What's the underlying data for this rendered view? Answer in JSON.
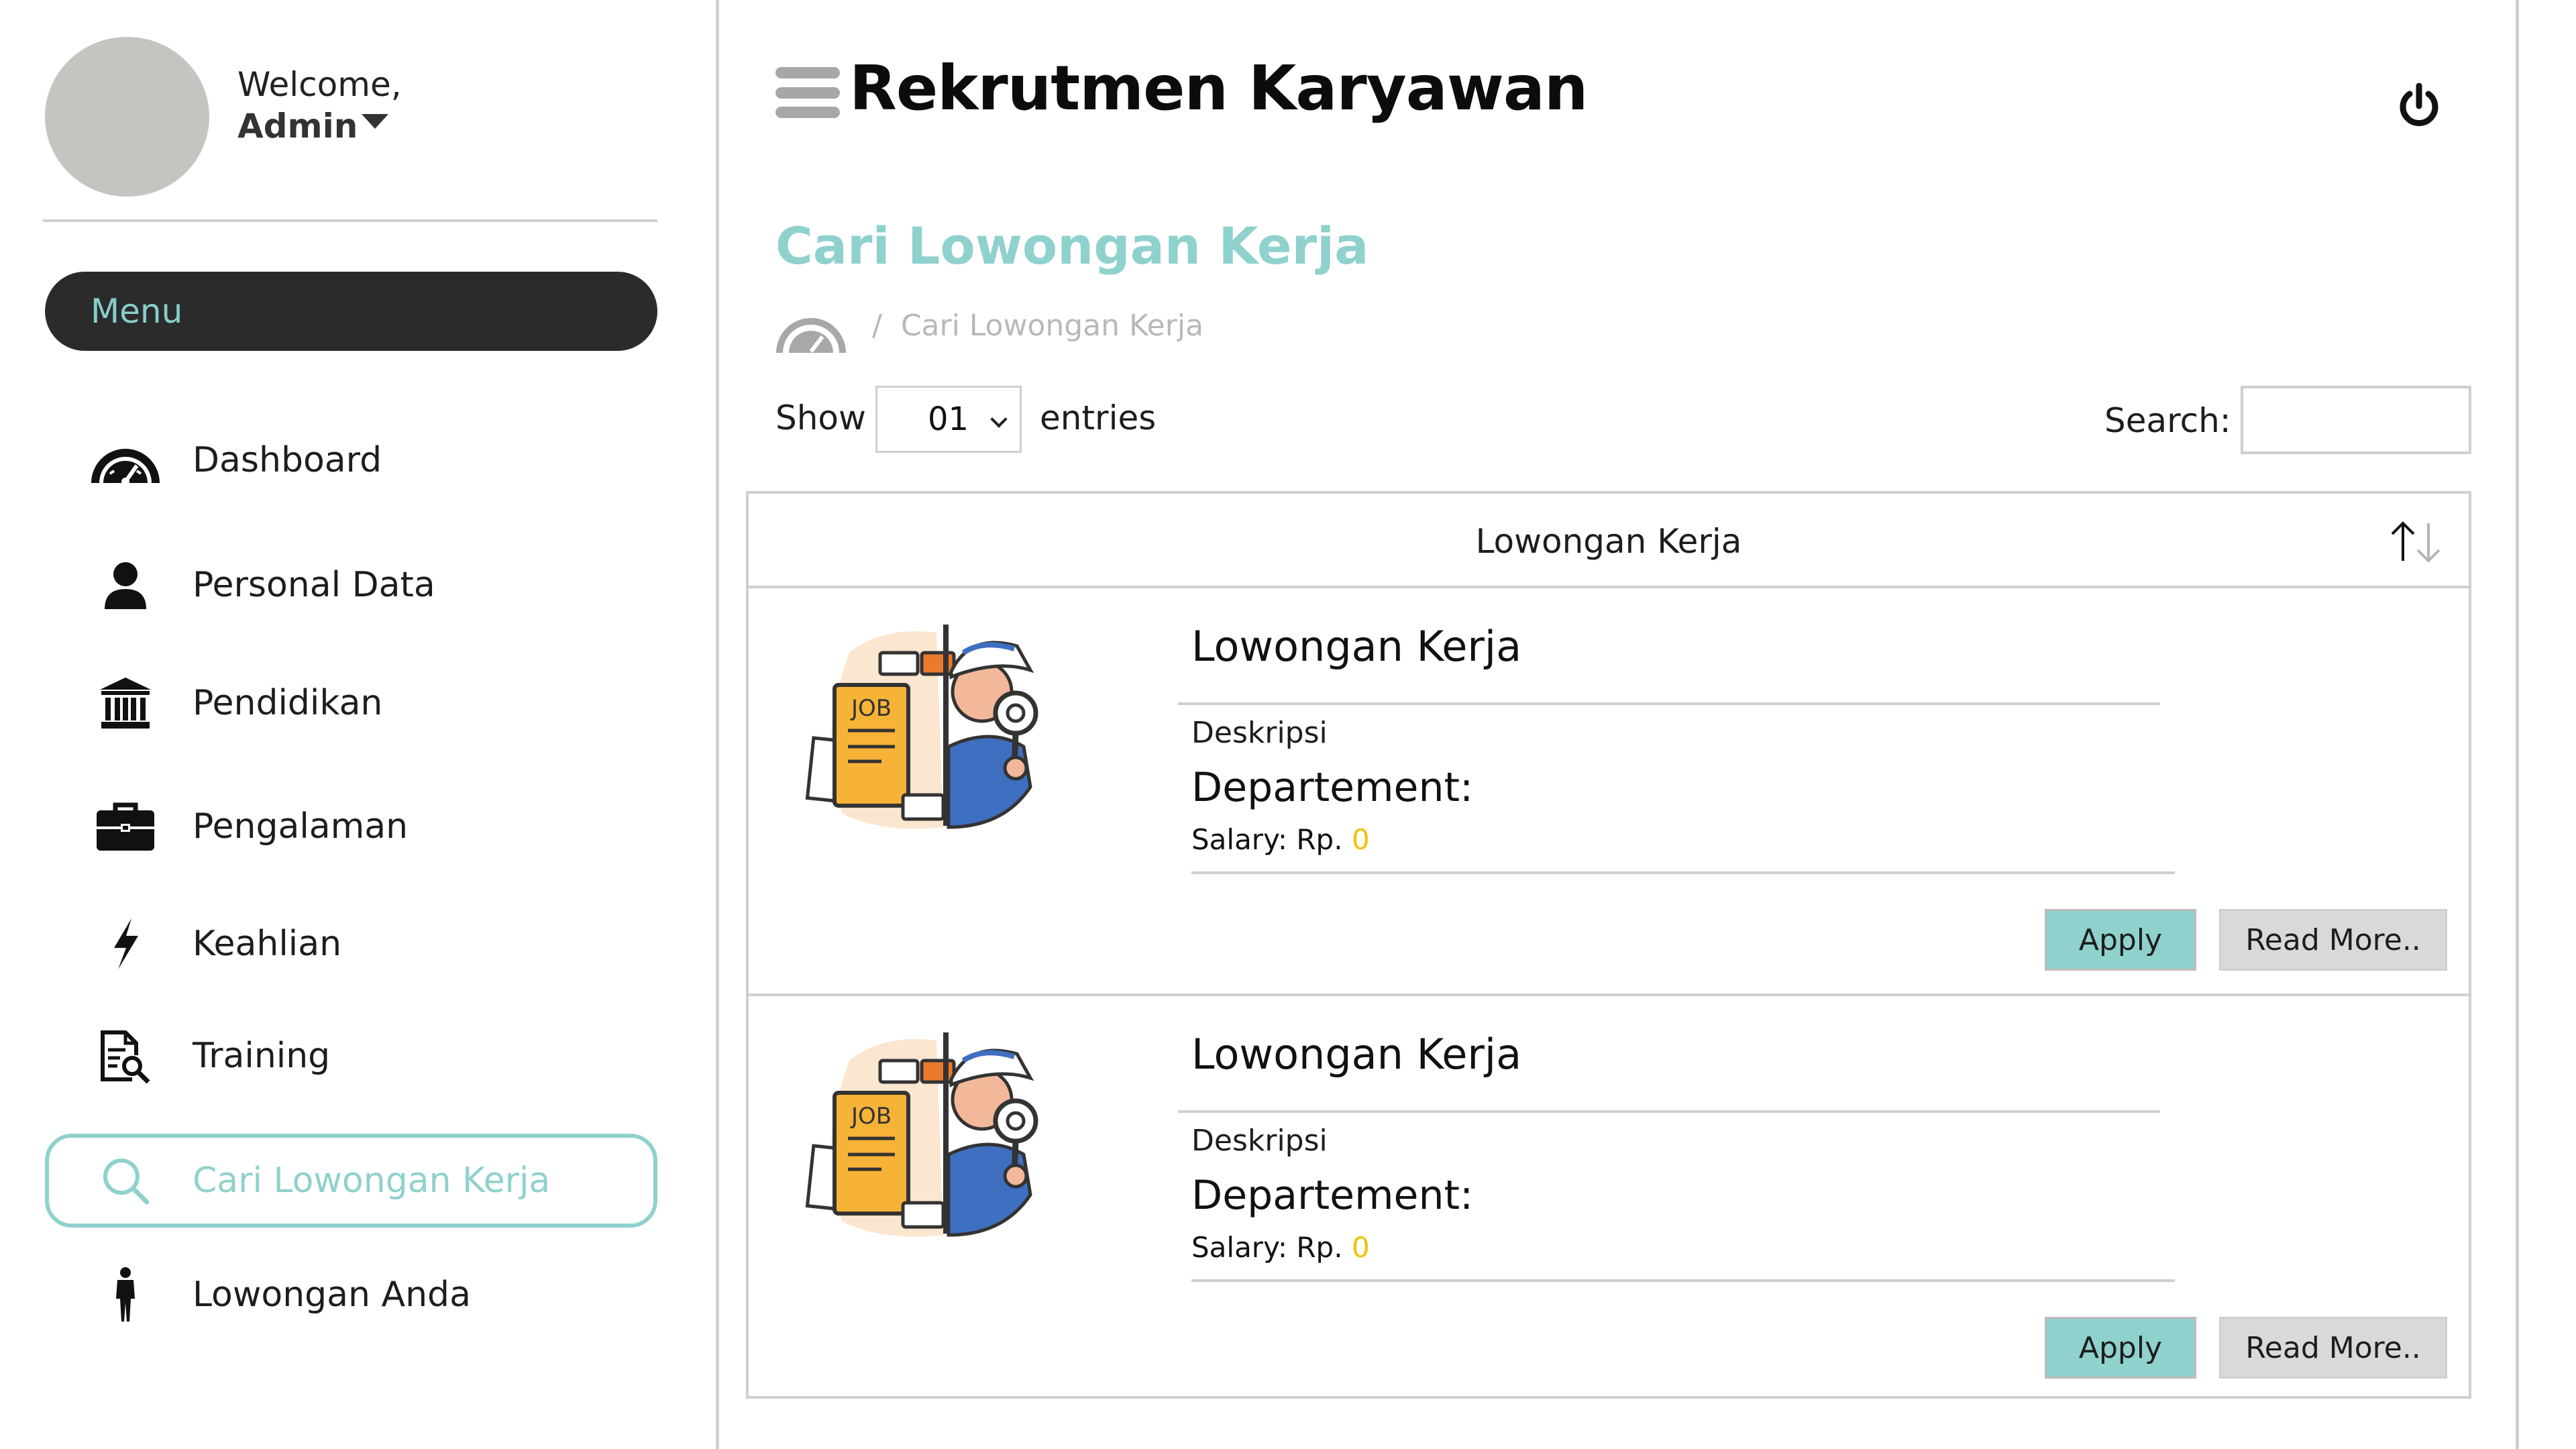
{
  "colors": {
    "accent": "#8fd1cd",
    "menu_pill_bg": "#2b2b2b",
    "salary_value": "#f2c100",
    "avatar_placeholder": "#c4c4c0",
    "read_more_bg": "#d9d9d9"
  },
  "profile": {
    "welcome": "Welcome,",
    "name": "Admin"
  },
  "sidebar": {
    "menu_header": "Menu",
    "items": [
      {
        "label": "Dashboard",
        "icon": "dashboard-gauge-icon"
      },
      {
        "label": "Personal Data",
        "icon": "user-icon"
      },
      {
        "label": "Pendidikan",
        "icon": "institution-icon"
      },
      {
        "label": "Pengalaman",
        "icon": "briefcase-icon"
      },
      {
        "label": "Keahlian",
        "icon": "lightning-icon"
      },
      {
        "label": "Training",
        "icon": "document-search-icon"
      },
      {
        "label": "Cari Lowongan Kerja",
        "icon": "search-icon",
        "active": true
      },
      {
        "label": "Lowongan Anda",
        "icon": "person-standing-icon"
      }
    ]
  },
  "header": {
    "title": "Rekrutmen Karyawan",
    "menu_icon": "hamburger-icon",
    "power_icon": "power-icon"
  },
  "page": {
    "title": "Cari Lowongan Kerja",
    "breadcrumb_separator": "/",
    "breadcrumb_current": "Cari Lowongan Kerja",
    "breadcrumb_icon": "dashboard-gauge-icon"
  },
  "table_controls": {
    "show_label": "Show",
    "entries_value": "01",
    "entries_label": "entries",
    "search_label": "Search:",
    "search_value": ""
  },
  "table": {
    "column_header": "Lowongan Kerja",
    "sort_icon": "sort-arrows-icon",
    "rows": [
      {
        "title": "Lowongan Kerja",
        "description_label": "Deskripsi",
        "department_label": "Departement:",
        "salary_label": "Salary: Rp.",
        "salary_value": "0",
        "image_icon": "job-search-detective-illustration",
        "image_text": "JOB",
        "apply_label": "Apply",
        "read_more_label": "Read More.."
      },
      {
        "title": "Lowongan Kerja",
        "description_label": "Deskripsi",
        "department_label": "Departement:",
        "salary_label": "Salary: Rp.",
        "salary_value": "0",
        "image_icon": "job-search-detective-illustration",
        "image_text": "JOB",
        "apply_label": "Apply",
        "read_more_label": "Read More.."
      }
    ]
  }
}
